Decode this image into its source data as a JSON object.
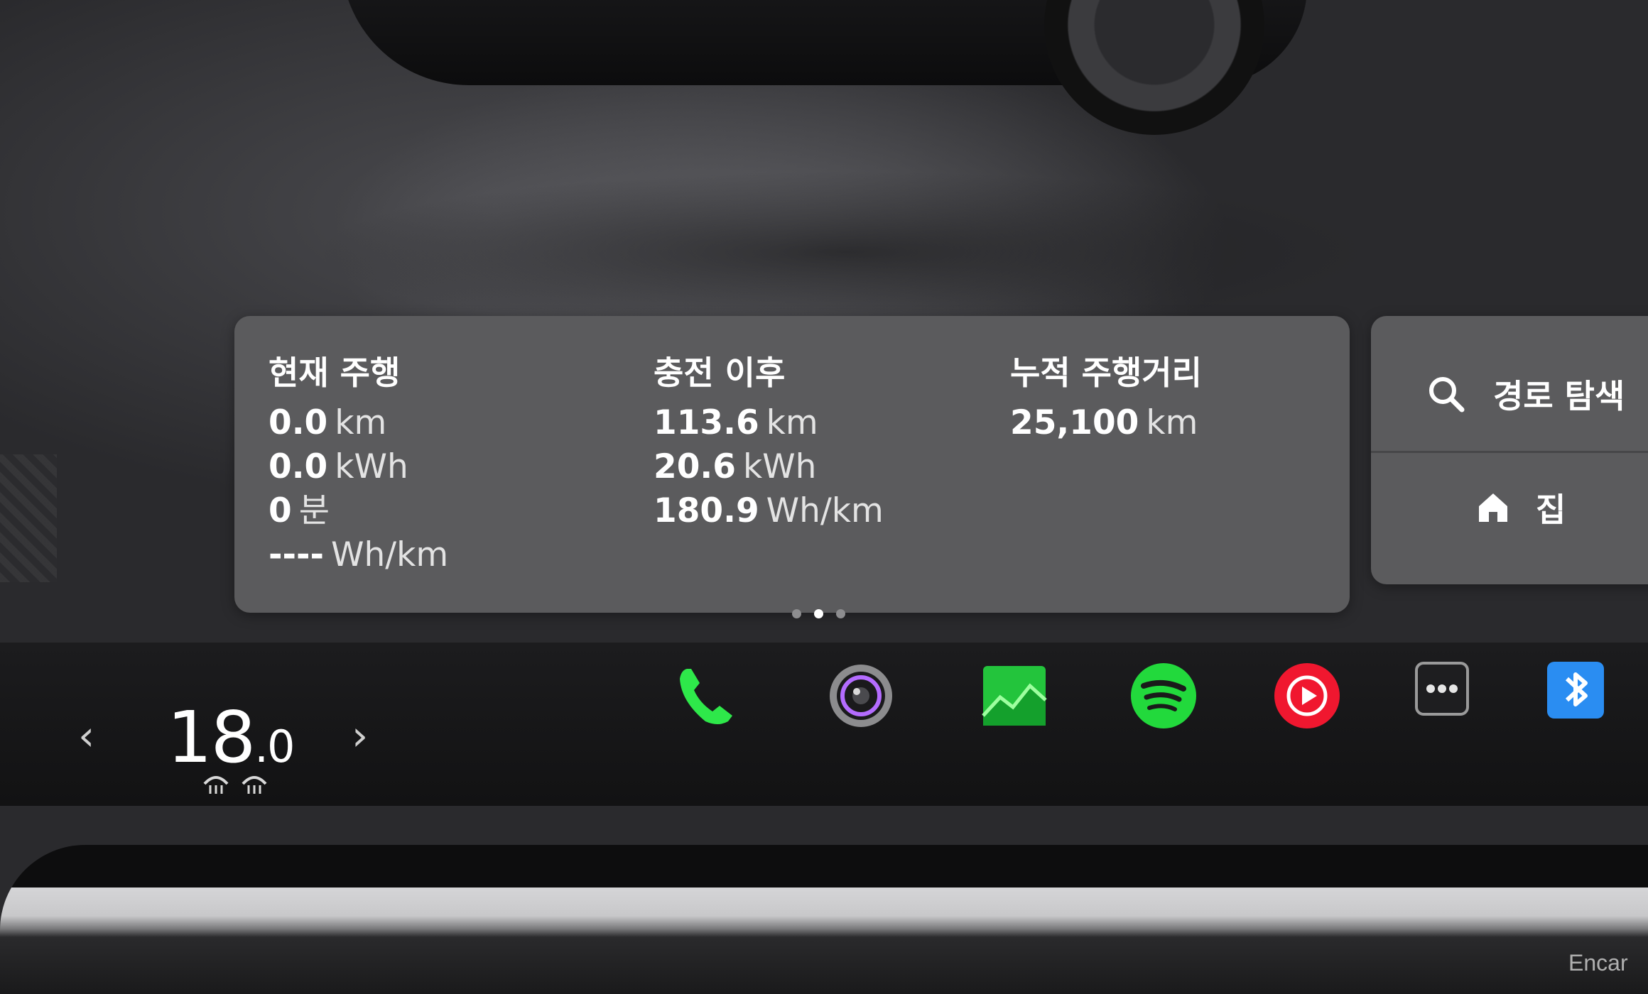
{
  "trip": {
    "current": {
      "title": "현재 주행",
      "rows": [
        {
          "value": "0.0",
          "unit": "km"
        },
        {
          "value": "0.0",
          "unit": "kWh"
        },
        {
          "value": "0",
          "unit": "분"
        },
        {
          "value": "----",
          "unit": "Wh/km"
        }
      ]
    },
    "since_charge": {
      "title": "충전 이후",
      "rows": [
        {
          "value": "113.6",
          "unit": "km"
        },
        {
          "value": "20.6",
          "unit": "kWh"
        },
        {
          "value": "180.9",
          "unit": "Wh/km"
        }
      ]
    },
    "odometer": {
      "title": "누적 주행거리",
      "rows": [
        {
          "value": "25,100",
          "unit": "km"
        }
      ]
    }
  },
  "navigation": {
    "search_label": "경로 탐색",
    "home_label": "집"
  },
  "pager": {
    "count": 3,
    "active": 2
  },
  "climate": {
    "temperature_int": "18",
    "temperature_dec": ".0",
    "left_arrow": "‹",
    "right_arrow": "›"
  },
  "dock_apps": [
    {
      "name": "phone",
      "icon": "phone-icon",
      "color": "#2ee84a"
    },
    {
      "name": "camera",
      "icon": "camera-icon",
      "color": "#b46cff"
    },
    {
      "name": "energy",
      "icon": "energy-chart-icon",
      "color": "#23c43c"
    },
    {
      "name": "spotify",
      "icon": "spotify-icon",
      "color": "#22d93c"
    },
    {
      "name": "media-player",
      "icon": "play-icon",
      "color": "#f0172f"
    },
    {
      "name": "more",
      "icon": "more-icon",
      "color": "#9a9a9a"
    },
    {
      "name": "bluetooth",
      "icon": "bluetooth-icon",
      "color": "#2a8df2"
    }
  ],
  "watermark": "Encar"
}
